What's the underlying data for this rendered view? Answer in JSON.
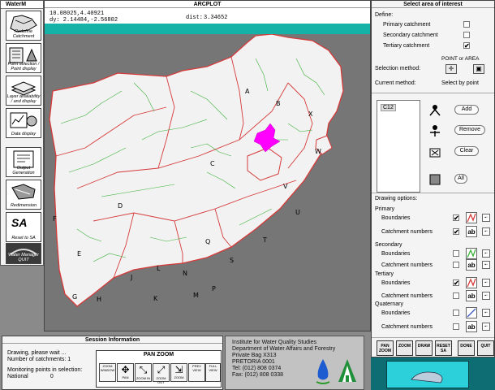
{
  "left_toolbar": {
    "title": "WaterM",
    "tools": [
      {
        "label": "Redefine Catchment",
        "icon": "redefine-catchment-icon"
      },
      {
        "label": "Point selection / Point display",
        "icon": "point-selection-icon"
      },
      {
        "label": "Layer availability / and display",
        "icon": "layer-availability-icon"
      },
      {
        "label": "Data display",
        "icon": "data-display-icon"
      },
      {
        "label": "Output Generation",
        "icon": "output-generation-icon"
      },
      {
        "label": "Redimension",
        "icon": "redimension-icon"
      },
      {
        "label": "Reset to SA",
        "icon": "reset-sa-icon"
      },
      {
        "label": "Water Manager QUIT",
        "icon": "quit-icon"
      }
    ],
    "sa_label": "SA"
  },
  "arcplot": {
    "title": "ARCPLOT",
    "coord_xy": "10.08025,4.40921",
    "coord_d": "dy: 2.14484,-2.56802",
    "dist_label": "dist:",
    "dist_value": "3.34652",
    "map_labels": [
      "A",
      "B",
      "X",
      "W",
      "C",
      "D",
      "V",
      "U",
      "F",
      "T",
      "E",
      "S",
      "J",
      "L",
      "N",
      "K",
      "M",
      "P",
      "G",
      "H",
      "Q"
    ]
  },
  "right_panel": {
    "title": "Select area of interest",
    "define_label": "Define:",
    "primary_label": "Primary catchment",
    "secondary_label": "Secondary catchment",
    "tertiary_label": "Tertiary catchment",
    "point_or_area": "POINT or AREA",
    "selection_method_label": "Selection method:",
    "current_method_label": "Current method:",
    "current_method_value": "Select by point",
    "list_items": [
      "C12"
    ],
    "add_label": "Add",
    "remove_label": "Remove",
    "clear_label": "Clear",
    "all_label": "All",
    "drawing_options": "Drawing options:",
    "groups": [
      {
        "name": "Primary",
        "boundaries": "Boundaries",
        "numbers": "Catchment numbers",
        "color": "#d63a3a"
      },
      {
        "name": "Secondary",
        "boundaries": "Boundaries",
        "numbers": "Catchment numbers",
        "color": "#3ab03a"
      },
      {
        "name": "Tertiary",
        "boundaries": "Boundaries",
        "numbers": "Catchment numbers",
        "color": "#d63a3a"
      },
      {
        "name": "Quaternary",
        "boundaries": "Boundaries",
        "numbers": "Catchment numbers",
        "color": "#3a55c8"
      }
    ],
    "ab_label": "ab",
    "bottom_buttons": [
      "PAN ZOOM",
      "ZOOM",
      "DRAW",
      "RESET SA",
      "DONE",
      "QUIT"
    ]
  },
  "session": {
    "title": "Session Information",
    "line1": "Drawing, please wait ...",
    "line2": "Number of catchments: 1",
    "line3": "Monitoring points in selection:",
    "line4": "National              0",
    "panzoom_title": "PAN ZOOM",
    "panzoom_buttons": [
      "ZOOM WINDOW",
      "PAN",
      "ZOOM IN",
      "ZOOM OUT",
      "ZOOM",
      "PREV VIEW",
      "FULL VIEW"
    ]
  },
  "institute": {
    "lines": [
      "Institute for Water Quality Studies",
      "Department of Water Affairs and Forestry",
      "Private Bag X313",
      "PRETORIA 0001",
      "Tel: (012) 808 0374",
      "Fax: (012) 808 0338"
    ]
  },
  "colors": {
    "teal": "#15b2a8",
    "highlight": "#ff00ff",
    "primary_boundary": "#d63a3a",
    "tertiary_boundary": "#3ab03a"
  }
}
